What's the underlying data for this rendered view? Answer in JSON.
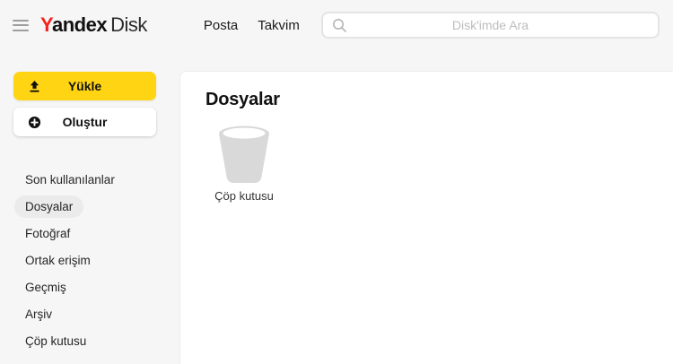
{
  "header": {
    "logo": {
      "brand_first_letter": "Y",
      "brand_rest": "andex",
      "product": "Disk"
    },
    "nav": [
      {
        "label": "Posta"
      },
      {
        "label": "Takvim"
      }
    ],
    "search": {
      "placeholder": "Disk'imde Ara",
      "value": ""
    }
  },
  "sidebar": {
    "upload_button": "Yükle",
    "create_button": "Oluştur",
    "items": [
      {
        "label": "Son kullanılanlar",
        "active": false
      },
      {
        "label": "Dosyalar",
        "active": true
      },
      {
        "label": "Fotoğraf",
        "active": false
      },
      {
        "label": "Ortak erişim",
        "active": false
      },
      {
        "label": "Geçmiş",
        "active": false
      },
      {
        "label": "Arşiv",
        "active": false
      },
      {
        "label": "Çöp kutusu",
        "active": false
      }
    ]
  },
  "main": {
    "title": "Dosyalar",
    "tiles": [
      {
        "label": "Çöp kutusu",
        "icon": "trash-bin-icon"
      }
    ]
  },
  "colors": {
    "accent_yellow": "#ffd412",
    "brand_red": "#f2241d",
    "page_background": "#f6f6f6",
    "active_pill": "#ebebeb",
    "panel_border": "#ececec",
    "trash_icon_gray": "#d9d9d9"
  }
}
